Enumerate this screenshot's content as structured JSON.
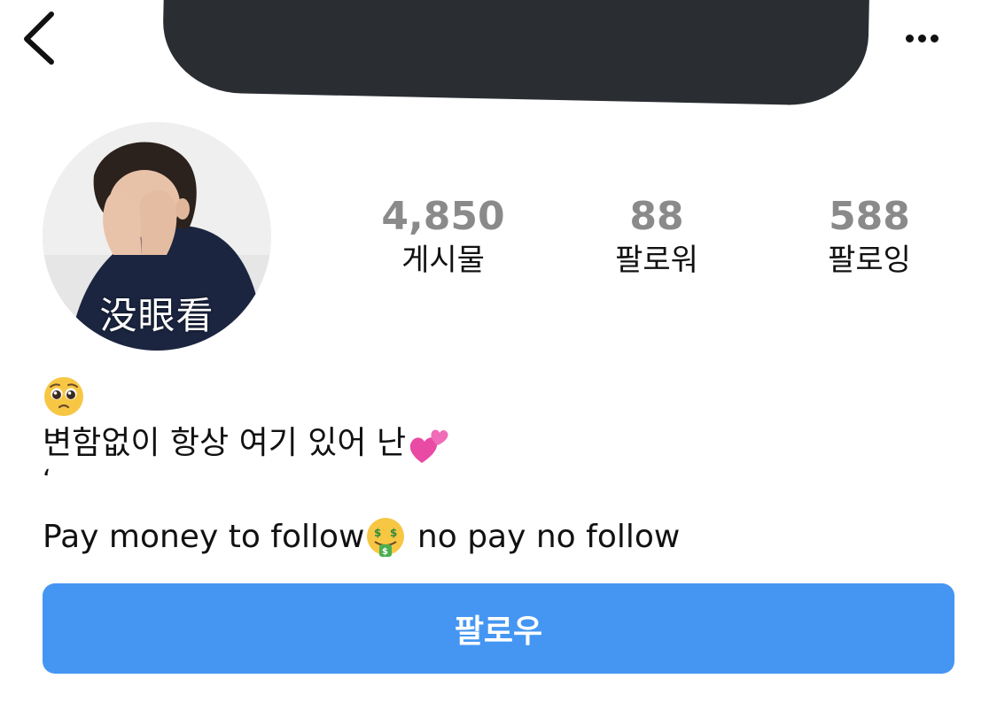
{
  "header": {
    "back_icon": "chevron-left-icon",
    "more_icon": "more-horizontal-icon"
  },
  "profile": {
    "avatar_caption": "没眼看"
  },
  "stats": {
    "posts": {
      "value": "4,850",
      "label": "게시물"
    },
    "followers": {
      "value": "88",
      "label": "팔로워"
    },
    "following": {
      "value": "588",
      "label": "팔로잉"
    }
  },
  "bio": {
    "line1_emoji": "pleading-face-emoji",
    "line2_text": "변함없이 항상 여기 있어 난",
    "line2_emoji": "two-hearts-emoji",
    "line3_mark": "ʻ",
    "line4_text_a": "Pay money to follow",
    "line4_emoji": "money-mouth-face-emoji",
    "line4_text_b": " no pay no follow"
  },
  "actions": {
    "follow_label": "팔로우"
  },
  "colors": {
    "follow_button": "#4596f2",
    "stat_value": "#8a8a8a",
    "redaction": "#2a2e33"
  }
}
